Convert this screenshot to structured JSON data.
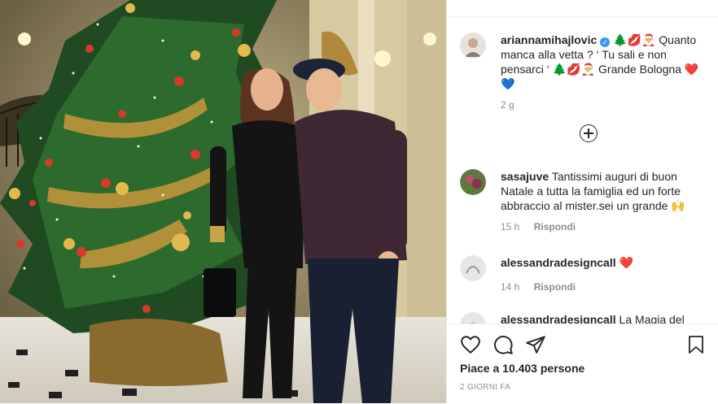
{
  "post": {
    "caption": {
      "username": "ariannamihajlovic",
      "text_part1": "Quanto manca alla vetta ? ‘ Tu sali e non pensarci ‘",
      "text_part2": "Grande Bologna",
      "verified_mark": "✓",
      "emoji_tree": "🌲",
      "emoji_kiss": "💋",
      "emoji_santa": "🎅",
      "heart": "❤️",
      "blue_heart": "💙",
      "time": "2 g"
    },
    "comments": [
      {
        "username": "sasajuve",
        "text": "Tantissimi auguri di buon Natale a tutta la famiglia ed un forte abbraccio al mister.sei un grande",
        "emoji": "🙌",
        "time": "15 h",
        "reply": "Rispondi"
      },
      {
        "username": "alessandradesigncall",
        "text": "",
        "emoji": "❤️",
        "time": "14 h",
        "reply": "Rispondi"
      },
      {
        "username": "alessandradesigncall",
        "text": "La Magia del",
        "emoji": ""
      }
    ],
    "likes": "Piace a 10.403 persone",
    "date": "2 GIORNI FA"
  },
  "icons": [
    "heart-outline-icon",
    "comment-icon",
    "share-icon",
    "bookmark-icon",
    "plus-circle-icon"
  ]
}
